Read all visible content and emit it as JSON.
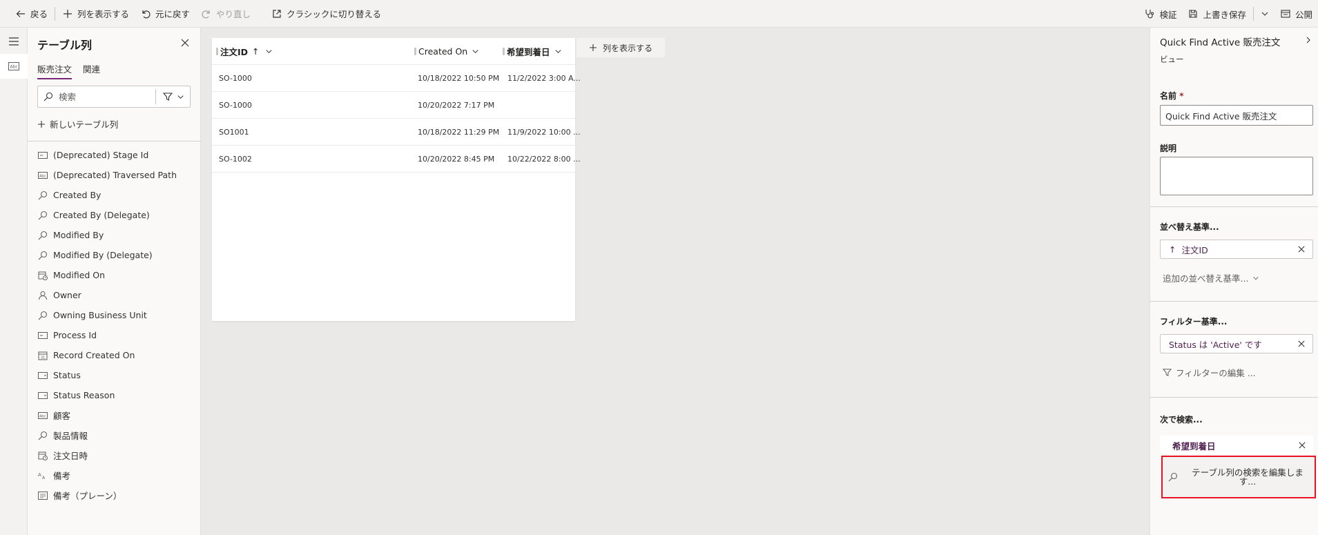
{
  "toolbar": {
    "back": "戻る",
    "show_columns": "列を表示する",
    "undo": "元に戻す",
    "redo": "やり直し",
    "classic": "クラシックに切り替える",
    "validate": "検証",
    "save_overwrite": "上書き保存",
    "publish": "公開"
  },
  "columns_pane": {
    "title": "テーブル列",
    "tabs": [
      "販売注文",
      "関連"
    ],
    "search_placeholder": "検索",
    "new_column": "新しいテーブル列",
    "items": [
      {
        "label": "(Deprecated) Stage Id",
        "icon": "id-field-icon"
      },
      {
        "label": "(Deprecated) Traversed Path",
        "icon": "text-field-icon"
      },
      {
        "label": "Created By",
        "icon": "lookup-icon"
      },
      {
        "label": "Created By (Delegate)",
        "icon": "lookup-icon"
      },
      {
        "label": "Modified By",
        "icon": "lookup-icon"
      },
      {
        "label": "Modified By (Delegate)",
        "icon": "lookup-icon"
      },
      {
        "label": "Modified On",
        "icon": "datetime-icon"
      },
      {
        "label": "Owner",
        "icon": "person-icon"
      },
      {
        "label": "Owning Business Unit",
        "icon": "lookup-icon"
      },
      {
        "label": "Process Id",
        "icon": "id-field-icon"
      },
      {
        "label": "Record Created On",
        "icon": "calendar-icon"
      },
      {
        "label": "Status",
        "icon": "choice-icon"
      },
      {
        "label": "Status Reason",
        "icon": "choice-icon"
      },
      {
        "label": "顧客",
        "icon": "text-field-icon"
      },
      {
        "label": "製品情報",
        "icon": "lookup-icon"
      },
      {
        "label": "注文日時",
        "icon": "datetime-icon"
      },
      {
        "label": "備考",
        "icon": "rich-text-icon"
      },
      {
        "label": "備考（プレーン）",
        "icon": "multiline-text-icon"
      }
    ]
  },
  "grid": {
    "headers": [
      {
        "label": "注文ID",
        "sort": "↑"
      },
      {
        "label": "Created On"
      },
      {
        "label": "希望到着日"
      }
    ],
    "rows": [
      [
        "SO-1000",
        "10/18/2022 10:50 PM",
        "11/2/2022 3:00 A..."
      ],
      [
        "SO-1000",
        "10/20/2022 7:17 PM",
        ""
      ],
      [
        "SO1001",
        "10/18/2022 11:29 PM",
        "11/9/2022 10:00 ..."
      ],
      [
        "SO-1002",
        "10/20/2022 8:45 PM",
        "10/22/2022 8:00 ..."
      ]
    ],
    "add_column": "列を表示する"
  },
  "properties": {
    "title": "Quick Find Active 販売注文",
    "subtitle": "ビュー",
    "name_label": "名前",
    "required_mark": "*",
    "name_value": "Quick Find Active 販売注文",
    "description_label": "説明",
    "sort_label": "並べ替え基準...",
    "sort_chip": "注文ID",
    "sort_chip_arrow": "↑",
    "more_sort": "追加の並べ替え基準...",
    "filter_label": "フィルター基準...",
    "filter_chip": "Status は 'Active' です",
    "edit_filter": "フィルターの編集 ...",
    "find_label": "次で検索...",
    "find_chip": "希望到着日",
    "edit_find": "テーブル列の検索を編集します..."
  }
}
